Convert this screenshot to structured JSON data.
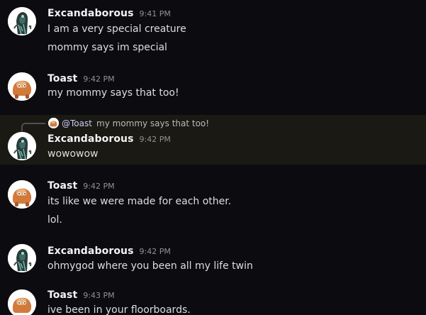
{
  "messages": [
    {
      "author": "Excandaborous",
      "timestamp": "9:41 PM",
      "avatar": "dark-creature-avatar",
      "lines": [
        "I am a very special creature",
        "mommy says im special"
      ]
    },
    {
      "author": "Toast",
      "timestamp": "9:42 PM",
      "avatar": "orange-creature-avatar",
      "lines": [
        "my mommy says that too!"
      ]
    },
    {
      "author": "Excandaborous",
      "timestamp": "9:42 PM",
      "avatar": "dark-creature-avatar",
      "reply": {
        "mention": "@Toast",
        "text": "my mommy says that too!"
      },
      "lines": [
        "wowowow"
      ]
    },
    {
      "author": "Toast",
      "timestamp": "9:42 PM",
      "avatar": "orange-creature-avatar",
      "lines": [
        "its like we were made for each other.",
        "lol."
      ]
    },
    {
      "author": "Excandaborous",
      "timestamp": "9:42 PM",
      "avatar": "dark-creature-avatar",
      "lines": [
        "ohmygod where you been all my life twin"
      ]
    },
    {
      "author": "Toast",
      "timestamp": "9:43 PM",
      "avatar": "orange-creature-avatar",
      "lines": [
        "ive been in your floorboards."
      ]
    }
  ],
  "colors": {
    "background": "#0c0c10",
    "highlight": "#1b1913",
    "username": "#f2f3f5",
    "text": "#dbdee1",
    "timestamp": "#8e9297",
    "mention": "#c9cdfb"
  }
}
